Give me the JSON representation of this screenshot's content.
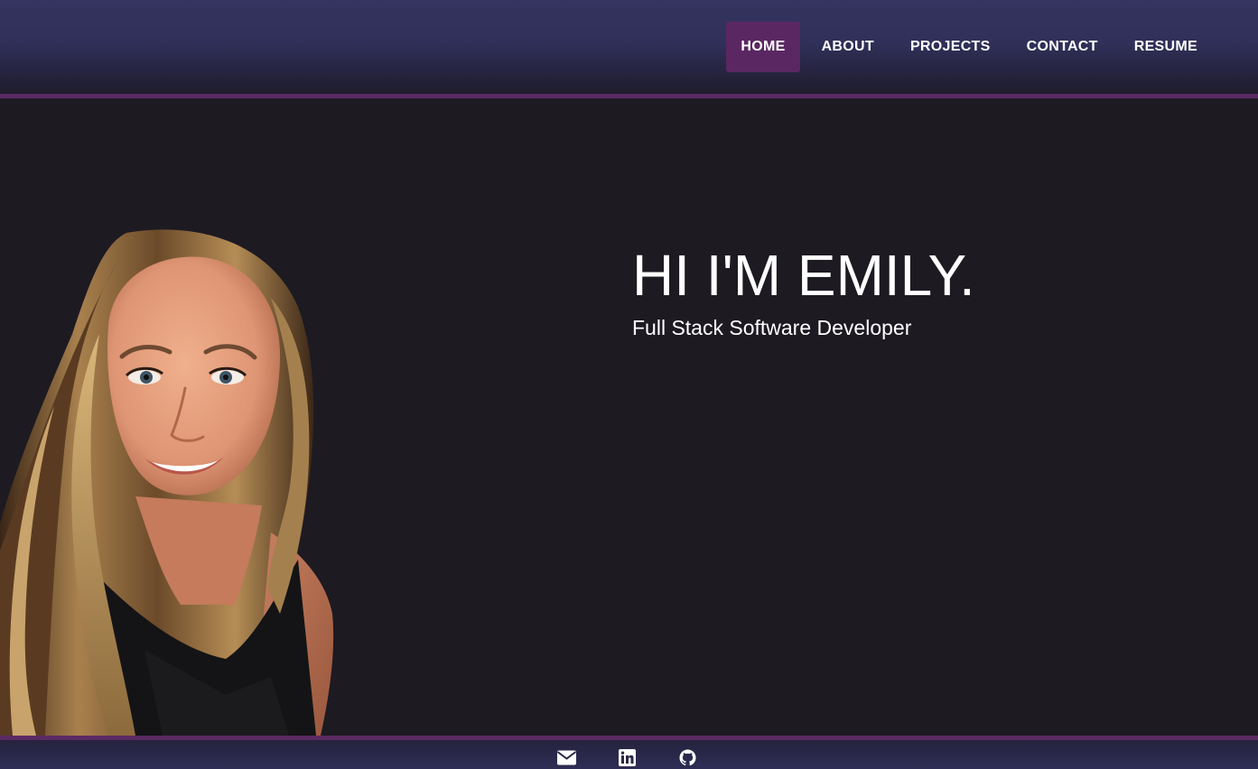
{
  "nav": {
    "items": [
      {
        "label": "HOME",
        "active": true
      },
      {
        "label": "ABOUT",
        "active": false
      },
      {
        "label": "PROJECTS",
        "active": false
      },
      {
        "label": "CONTACT",
        "active": false
      },
      {
        "label": "RESUME",
        "active": false
      }
    ]
  },
  "hero": {
    "title": "HI I'M EMILY.",
    "subtitle": "Full Stack Software Developer",
    "portrait_icon": "profile-photo"
  },
  "footer": {
    "icons": [
      "envelope-icon",
      "linkedin-icon",
      "github-icon"
    ]
  },
  "colors": {
    "page_background": "#1d1a22",
    "header_top": "#343460",
    "accent_border": "#5b2a63",
    "active_nav": "#5a2762",
    "text": "#ffffff"
  }
}
